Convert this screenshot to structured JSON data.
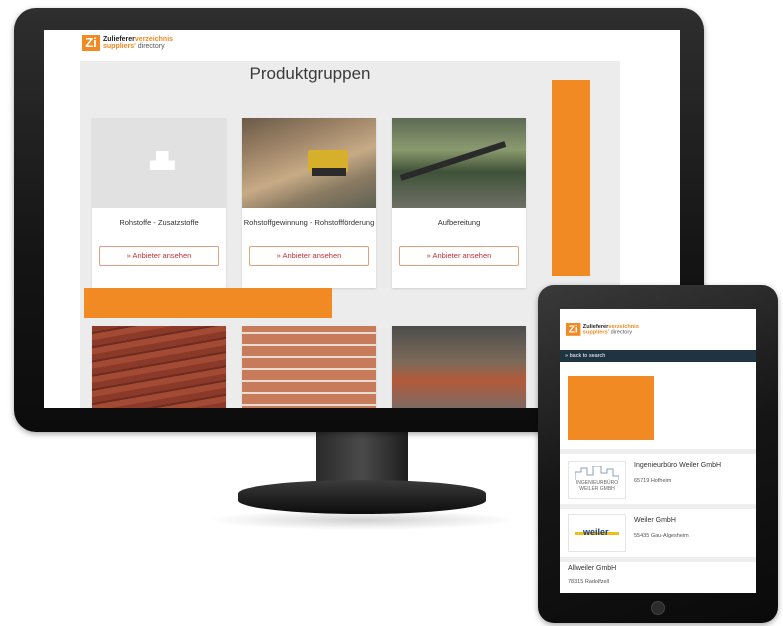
{
  "logo": {
    "mark": "Zi",
    "line1_prefix": "Zulieferer",
    "line1_suffix": "verzeichnis",
    "line2_prefix": "suppliers'",
    "line2_suffix": " directory"
  },
  "desktop": {
    "title": "Produktgruppen",
    "cards": [
      {
        "label": "Rohstoffe - Zusatzstoffe",
        "button": "» Anbieter ansehen",
        "image": "placeholder"
      },
      {
        "label": "Rohstoffgewinnung - Rohstoffförderung",
        "button": "» Anbieter ansehen",
        "image": "quarry"
      },
      {
        "label": "Aufbereitung",
        "button": "» Anbieter ansehen",
        "image": "plant"
      }
    ],
    "bottom_cards": [
      {
        "image": "bricks-stack"
      },
      {
        "image": "brick-wall"
      },
      {
        "image": "kiln"
      }
    ],
    "accent_color": "#f28a23"
  },
  "tablet": {
    "nav_link": "» back to search",
    "results": [
      {
        "company": "Ingenieurbüro Weiler GmbH",
        "address": "65719 Hofheim",
        "logo_text_1": "INGENIEURBÜRO",
        "logo_text_2": "WEILER GMBH"
      },
      {
        "company": "Weiler GmbH",
        "address": "55435 Gau-Algesheim",
        "logo_text_1": "weiler"
      },
      {
        "company": "Allweiler GmbH",
        "address": "78315 Radolfzell"
      }
    ],
    "nav_color": "#1e3440"
  }
}
